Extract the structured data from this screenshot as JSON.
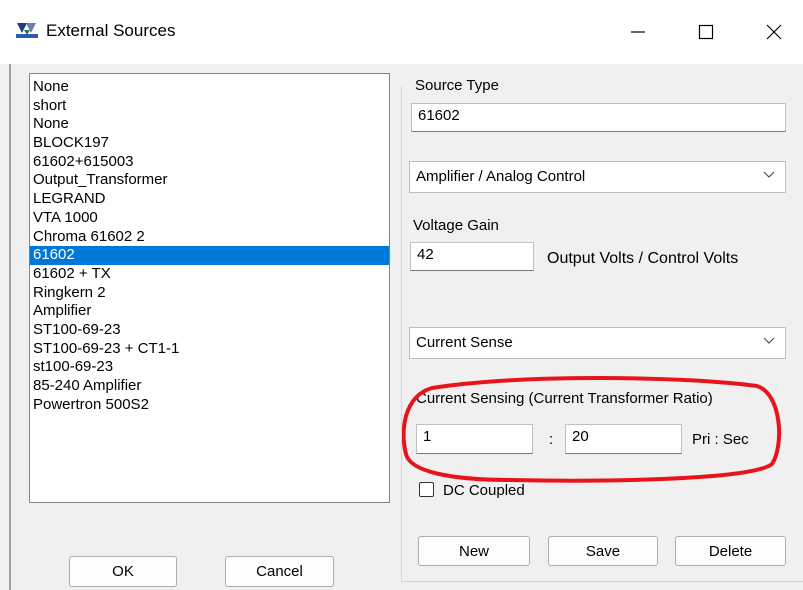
{
  "window": {
    "title": "External Sources",
    "icons": {
      "app": "app-logo-icon",
      "minimize": "minimize-icon",
      "maximize": "maximize-icon",
      "close": "close-icon"
    }
  },
  "sources_list": {
    "items": [
      "None",
      "short",
      "None",
      "BLOCK197",
      "61602+615003",
      "Output_Transformer",
      "LEGRAND",
      "VTA 1000",
      "Chroma 61602 2",
      "61602",
      "61602 + TX",
      "Ringkern 2",
      "Amplifier",
      "ST100-69-23",
      "ST100-69-23 + CT1-1",
      "st100-69-23",
      "85-240 Amplifier",
      "Powertron 500S2"
    ],
    "selected_index": 9
  },
  "buttons": {
    "ok": "OK",
    "cancel": "Cancel",
    "new": "New",
    "save": "Save",
    "delete": "Delete"
  },
  "source_type": {
    "label": "Source Type",
    "value": "61602",
    "type_select": "Amplifier / Analog Control"
  },
  "voltage_gain": {
    "label": "Voltage Gain",
    "value": "42",
    "units": "Output Volts / Control Volts"
  },
  "current_sense": {
    "select": "Current Sense",
    "group_label": "Current Sensing (Current Transformer Ratio)",
    "primary": "1",
    "separator": ":",
    "secondary": "20",
    "units": "Pri : Sec"
  },
  "dc_coupled": {
    "label": "DC Coupled",
    "checked": false
  },
  "colors": {
    "selection": "#0078d7",
    "annotation": "#e8141c"
  }
}
